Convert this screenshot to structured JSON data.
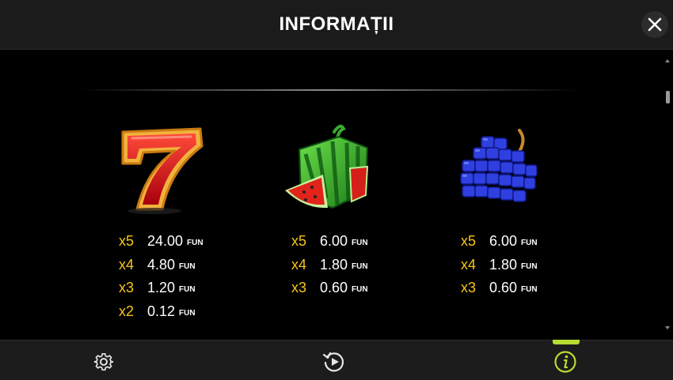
{
  "header": {
    "title": "INFORMAȚII",
    "close_icon": "close-icon"
  },
  "colors": {
    "multiplier": "#f7c51b",
    "accent": "#b7dc34",
    "header_bg": "#1b1b1b"
  },
  "symbols": [
    {
      "name": "red-seven",
      "icon": "seven-symbol-icon",
      "pays": [
        {
          "mult": "x5",
          "amount": "24.00",
          "currency": "FUN"
        },
        {
          "mult": "x4",
          "amount": "4.80",
          "currency": "FUN"
        },
        {
          "mult": "x3",
          "amount": "1.20",
          "currency": "FUN"
        },
        {
          "mult": "x2",
          "amount": "0.12",
          "currency": "FUN"
        }
      ]
    },
    {
      "name": "watermelon",
      "icon": "watermelon-symbol-icon",
      "pays": [
        {
          "mult": "x5",
          "amount": "6.00",
          "currency": "FUN"
        },
        {
          "mult": "x4",
          "amount": "1.80",
          "currency": "FUN"
        },
        {
          "mult": "x3",
          "amount": "0.60",
          "currency": "FUN"
        }
      ]
    },
    {
      "name": "grapes",
      "icon": "grapes-symbol-icon",
      "pays": [
        {
          "mult": "x5",
          "amount": "6.00",
          "currency": "FUN"
        },
        {
          "mult": "x4",
          "amount": "1.80",
          "currency": "FUN"
        },
        {
          "mult": "x3",
          "amount": "0.60",
          "currency": "FUN"
        }
      ]
    }
  ],
  "footer": {
    "buttons": [
      {
        "icon": "gear-icon",
        "active": false
      },
      {
        "icon": "replay-icon",
        "active": false
      },
      {
        "icon": "info-icon",
        "active": true
      }
    ]
  }
}
